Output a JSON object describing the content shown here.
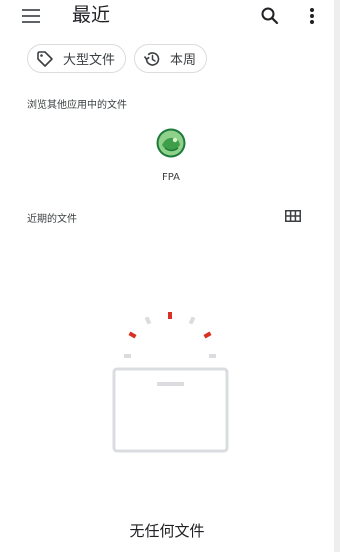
{
  "header": {
    "title": "最近",
    "menu_icon": "hamburger-menu-icon",
    "search_icon": "search-icon",
    "more_icon": "more-vert-icon"
  },
  "chips": [
    {
      "label": "大型文件",
      "icon": "label-tag-icon"
    },
    {
      "label": "本周",
      "icon": "history-icon"
    }
  ],
  "browse": {
    "heading": "浏览其他应用中的文件",
    "apps": [
      {
        "label": "FPA",
        "icon": "fpa-app-icon"
      }
    ]
  },
  "recent": {
    "heading": "近期的文件",
    "view_toggle_icon": "grid-view-icon"
  },
  "empty_state": {
    "message": "无任何文件"
  },
  "colors": {
    "accent_red": "#d93025",
    "placeholder_gray": "#dadce0",
    "app_icon_green": "#4caf50"
  }
}
